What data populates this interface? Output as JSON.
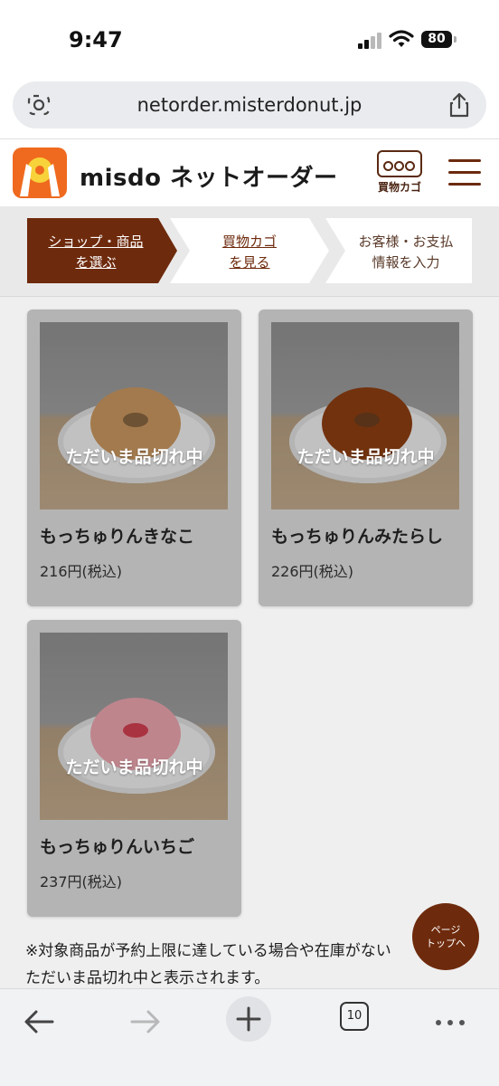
{
  "status": {
    "time": "9:47",
    "battery": "80"
  },
  "browser": {
    "url": "netorder.misterdonut.jp",
    "tab_count": "10"
  },
  "header": {
    "brand": "misdo ネットオーダー",
    "cart_label": "買物カゴ"
  },
  "steps": [
    {
      "line1": "ショップ・商品",
      "line2": "を選ぶ"
    },
    {
      "line1": "買物カゴ",
      "line2": "を見る"
    },
    {
      "line1": "お客様・お支払",
      "line2": "情報を入力"
    }
  ],
  "products": [
    {
      "name": "もっちゅりんきなこ",
      "price": "216円(税込)",
      "status": "ただいま品切れ中",
      "color": "#c7955e"
    },
    {
      "name": "もっちゅりんみたらし",
      "price": "226円(税込)",
      "status": "ただいま品切れ中",
      "color": "#8c3d12"
    },
    {
      "name": "もっちゅりんいちご",
      "price": "237円(税込)",
      "status": "ただいま品切れ中",
      "color": "#e8a3ad"
    }
  ],
  "note": {
    "line1": "※対象商品が予約上限に達している場合や在庫がない",
    "line2": "ただいま品切れ中と表示されます。"
  },
  "page_top": {
    "line1": "ページ",
    "line2": "トップへ"
  },
  "colors": {
    "brand": "#6e2a0c",
    "logo": "#ef6a1f"
  }
}
